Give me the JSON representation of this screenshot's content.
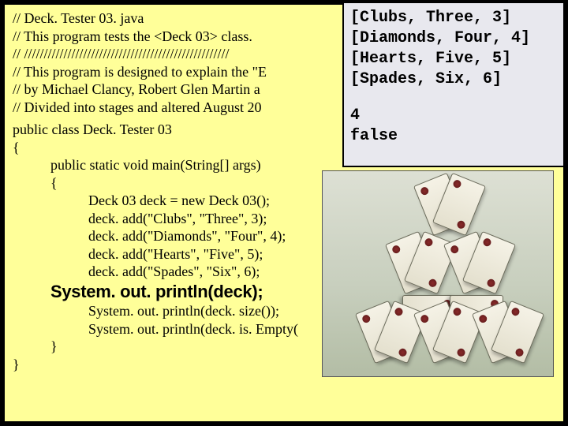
{
  "code": {
    "l1": "// Deck. Tester 03. java",
    "l2": "// This program tests the <Deck 03> class.",
    "l3": "// ////////////////////////////////////////////////////",
    "l4": "// This program is designed to explain the \"E",
    "l5": "// by Michael Clancy, Robert Glen Martin a",
    "l6": "// Divided into stages and altered August 20",
    "l7": "public class Deck. Tester 03",
    "l8": "{",
    "l9": "public static void main(String[] args)",
    "l10": "{",
    "l11": "Deck 03 deck = new Deck 03();",
    "l12": "deck. add(\"Clubs\", \"Three\", 3);",
    "l13": "deck. add(\"Diamonds\", \"Four\", 4);",
    "l14": "deck. add(\"Hearts\", \"Five\", 5);",
    "l15": "deck. add(\"Spades\", \"Six\", 6);",
    "l16": "System. out. println(deck);",
    "l17": "System. out. println(deck. size());",
    "l18": "System. out. println(deck. is. Empty(",
    "l19": "}",
    "l20": "}"
  },
  "output": {
    "o1": "[Clubs, Three, 3]",
    "o2": "[Diamonds, Four, 4]",
    "o3": "[Hearts, Five, 5]",
    "o4": "[Spades, Six, 6]",
    "o5": "4",
    "o6": "false"
  }
}
